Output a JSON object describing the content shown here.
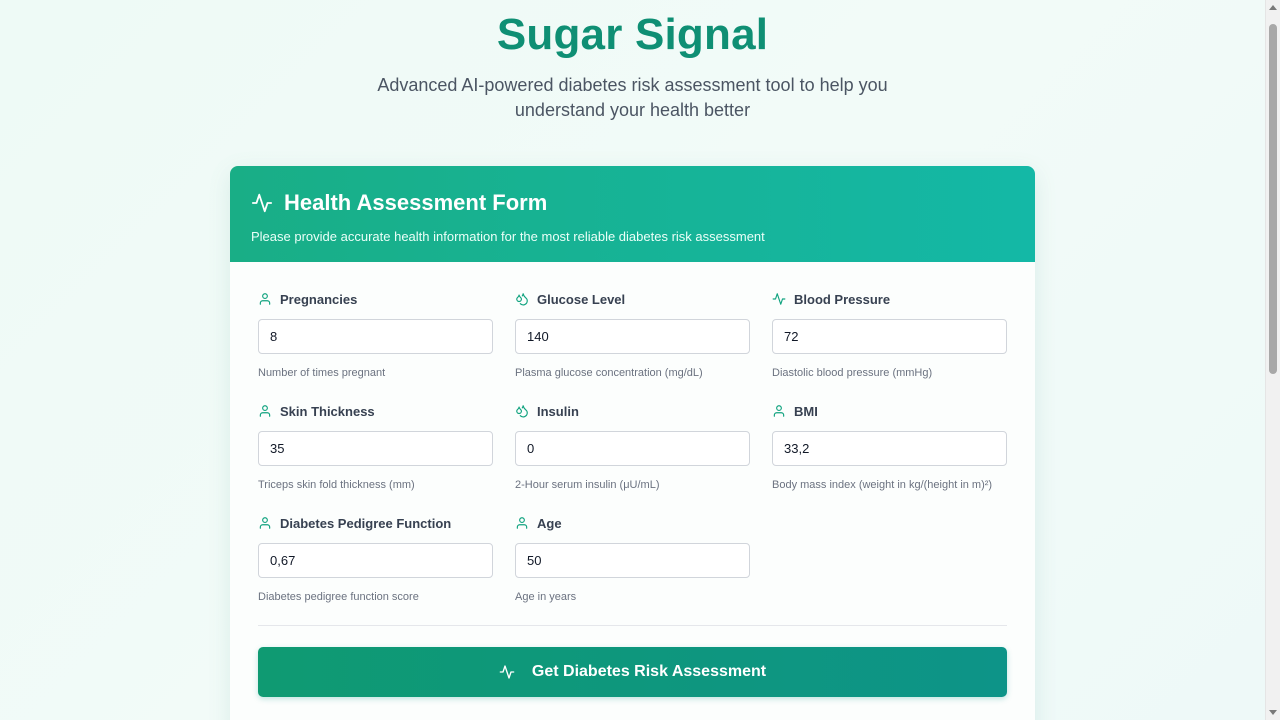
{
  "hero": {
    "title": "Sugar Signal",
    "subtitle": "Advanced AI-powered diabetes risk assessment tool to help you understand your health better"
  },
  "form": {
    "title": "Health Assessment Form",
    "description": "Please provide accurate health information for the most reliable diabetes risk assessment",
    "title_icon": "activity-icon",
    "fields": [
      {
        "label": "Pregnancies",
        "icon": "user-icon",
        "value": "8",
        "help": "Number of times pregnant"
      },
      {
        "label": "Glucose Level",
        "icon": "droplets-icon",
        "value": "140",
        "help": "Plasma glucose concentration (mg/dL)"
      },
      {
        "label": "Blood Pressure",
        "icon": "activity-icon",
        "value": "72",
        "help": "Diastolic blood pressure (mmHg)"
      },
      {
        "label": "Skin Thickness",
        "icon": "user-icon",
        "value": "35",
        "help": "Triceps skin fold thickness (mm)"
      },
      {
        "label": "Insulin",
        "icon": "droplets-icon",
        "value": "0",
        "help": "2-Hour serum insulin (μU/mL)"
      },
      {
        "label": "BMI",
        "icon": "user-icon",
        "value": "33,2",
        "help": "Body mass index (weight in kg/(height in m)²)"
      },
      {
        "label": "Diabetes Pedigree Function",
        "icon": "user-icon",
        "value": "0,67",
        "help": "Diabetes pedigree function score"
      },
      {
        "label": "Age",
        "icon": "user-icon",
        "value": "50",
        "help": "Age in years"
      }
    ],
    "submit_label": "Get Diabetes Risk Assessment",
    "submit_icon": "activity-icon"
  },
  "colors": {
    "brand": "#0f8f74",
    "header_gradient_start": "#19ae86",
    "header_gradient_end": "#14b8a6",
    "icon_accent": "#10a37f"
  }
}
